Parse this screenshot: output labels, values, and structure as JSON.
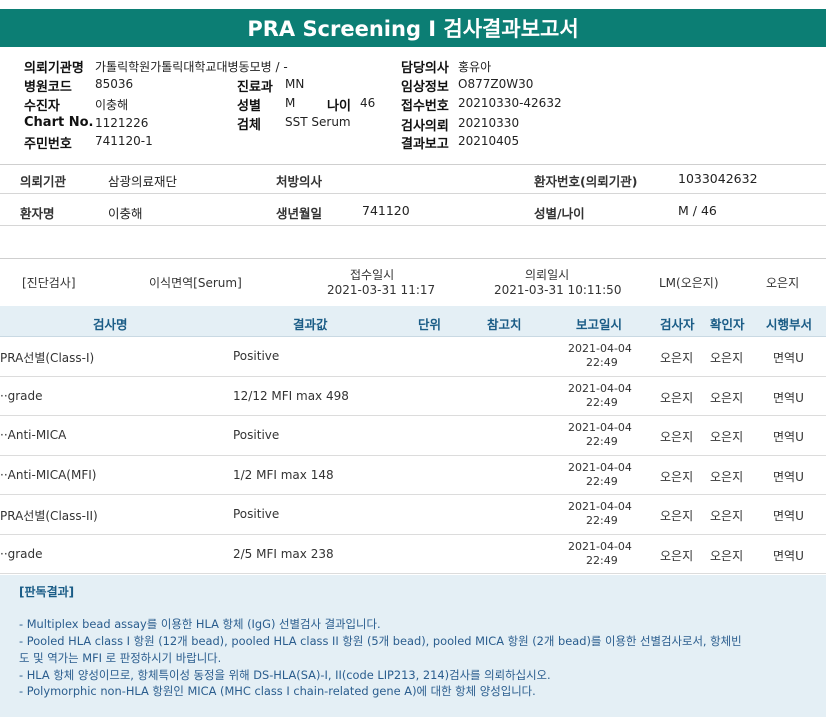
{
  "title": "PRA Screening I 검사결과보고서",
  "info": {
    "req_inst_label": "의뢰기관명",
    "req_inst_value": "가톨릭학원가톨릭대학교대병동모병 / -",
    "doctor_label": "담당의사",
    "doctor_value": "홍유아",
    "hosp_code_label": "병원코드",
    "hosp_code_value": "85036",
    "dept_label": "진료과",
    "dept_value": "MN",
    "clinical_label": "임상정보",
    "clinical_value": "O877Z0W30",
    "name_label": "수진자",
    "name_value": "이충해",
    "sex_label": "성별",
    "sex_value": "M",
    "age_label": "나이",
    "age_value": "46",
    "receipt_label": "접수번호",
    "receipt_value": "20210330-42632",
    "chart_label": "Chart No.",
    "chart_value": "1121226",
    "specimen_label": "검체",
    "specimen_value": "SST Serum",
    "request_label": "검사의뢰",
    "request_value": "20210330",
    "rrn_label": "주민번호",
    "rrn_value": "741120-1",
    "report_label": "결과보고",
    "report_value": "20210405"
  },
  "patient": {
    "req_inst_label": "의뢰기관",
    "req_inst_value": "삼광의료재단",
    "presc_label": "처방의사",
    "presc_value": "",
    "pt_no_label": "환자번호(의뢰기관)",
    "pt_no_value": "1033042632",
    "name_label": "환자명",
    "name_value": "이충해",
    "dob_label": "생년월일",
    "dob_value": "741120",
    "sex_age_label": "성별/나이",
    "sex_age_value": "M / 46"
  },
  "exam": {
    "category": "[진단검사]",
    "test": "이식면역[Serum]",
    "receipt_label": "접수일시",
    "receipt_value": "2021-03-31 11:17",
    "request_label": "의뢰일시",
    "request_value": "2021-03-31 10:11:50",
    "lm": "LM(오은지)",
    "person": "오은지"
  },
  "results": {
    "headers": [
      "검사명",
      "결과값",
      "단위",
      "참고치",
      "보고일시",
      "검사자",
      "확인자",
      "시행부서"
    ],
    "rows": [
      {
        "name": "PRA선별(Class-I)",
        "value": "Positive",
        "date": "2021-04-04",
        "time": "22:49",
        "tester": "오은지",
        "checker": "오은지",
        "dept": "면역U"
      },
      {
        "name": "··grade",
        "value": "12/12 MFI max 498",
        "date": "2021-04-04",
        "time": "22:49",
        "tester": "오은지",
        "checker": "오은지",
        "dept": "면역U"
      },
      {
        "name": "··Anti-MICA",
        "value": "Positive",
        "date": "2021-04-04",
        "time": "22:49",
        "tester": "오은지",
        "checker": "오은지",
        "dept": "면역U"
      },
      {
        "name": "··Anti-MICA(MFI)",
        "value": "1/2 MFI max 148",
        "date": "2021-04-04",
        "time": "22:49",
        "tester": "오은지",
        "checker": "오은지",
        "dept": "면역U"
      },
      {
        "name": "PRA선별(Class-II)",
        "value": "Positive",
        "date": "2021-04-04",
        "time": "22:49",
        "tester": "오은지",
        "checker": "오은지",
        "dept": "면역U"
      },
      {
        "name": "··grade",
        "value": "2/5 MFI max 238",
        "date": "2021-04-04",
        "time": "22:49",
        "tester": "오은지",
        "checker": "오은지",
        "dept": "면역U"
      }
    ]
  },
  "interpretation": {
    "title": "[판독결과]",
    "lines": [
      "- Multiplex bead assay를 이용한 HLA 항체 (IgG) 선별검사 결과입니다.",
      "- Pooled HLA class I 항원 (12개 bead), pooled HLA class II 항원 (5개 bead), pooled MICA 항원 (2개 bead)를 이용한 선별검사로서, 항체빈",
      "도 및 역가는 MFI 로 판정하시기 바랍니다.",
      "- HLA 항체 양성이므로, 항체특이성 동정을 위해 DS-HLA(SA)-I, II(code LIP213, 214)검사를 의뢰하십시오.",
      "- Polymorphic non-HLA 항원인 MICA (MHC class I chain-related gene A)에 대한 항체 양성입니다."
    ]
  },
  "colors": {
    "header_teal": "#0c7e74",
    "table_head_bg": "#e4eff5",
    "table_head_text": "#1a5c86",
    "interp_text": "#2a5d8e"
  }
}
